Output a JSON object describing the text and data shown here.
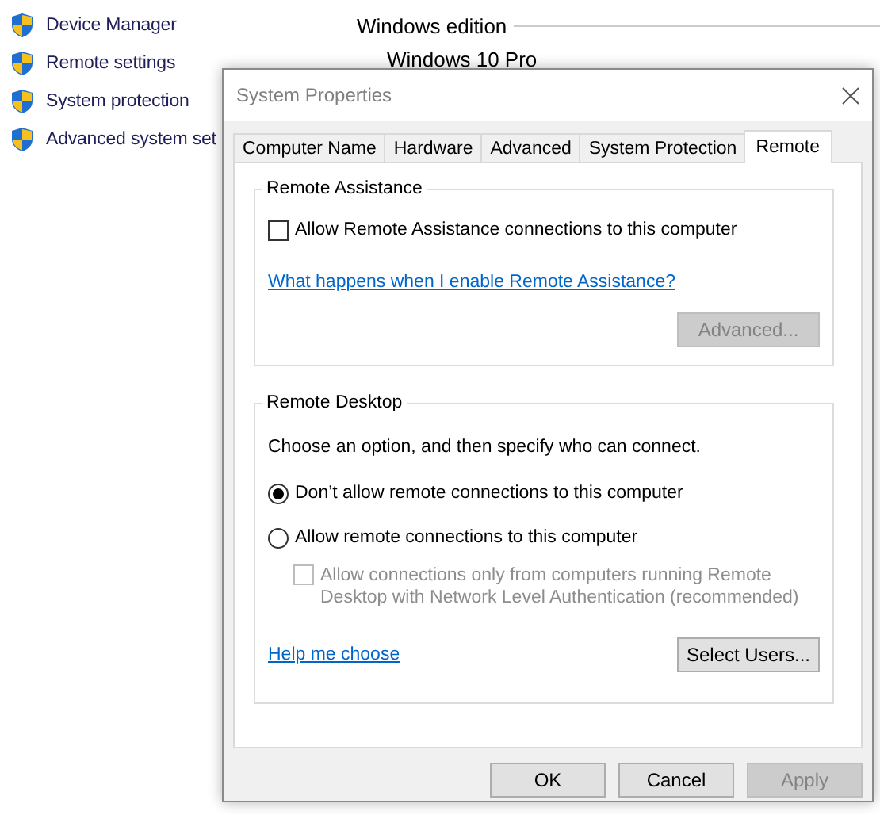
{
  "background": {
    "sidebar": {
      "items": [
        {
          "label": "Device Manager"
        },
        {
          "label": "Remote settings"
        },
        {
          "label": "System protection"
        },
        {
          "label": "Advanced system set"
        }
      ]
    },
    "section_title": "Windows edition",
    "edition": "Windows 10 Pro"
  },
  "dialog": {
    "title": "System Properties",
    "tabs": [
      {
        "label": "Computer Name",
        "selected": false
      },
      {
        "label": "Hardware",
        "selected": false
      },
      {
        "label": "Advanced",
        "selected": false
      },
      {
        "label": "System Protection",
        "selected": false
      },
      {
        "label": "Remote",
        "selected": true
      }
    ],
    "remote_assistance": {
      "title": "Remote Assistance",
      "allow": {
        "label": "Allow Remote Assistance connections to this computer",
        "checked": false
      },
      "help_link": "What happens when I enable Remote Assistance?",
      "advanced_button": {
        "label": "Advanced...",
        "disabled": true
      }
    },
    "remote_desktop": {
      "title": "Remote Desktop",
      "instructions": "Choose an option, and then specify who can connect.",
      "options": [
        {
          "label": "Don’t allow remote connections to this computer",
          "selected": true
        },
        {
          "label": "Allow remote connections to this computer",
          "selected": false
        }
      ],
      "nla": {
        "label": "Allow connections only from computers running Remote Desktop with Network Level Authentication (recommended)",
        "checked": false,
        "disabled": true
      },
      "help_link": "Help me choose",
      "select_users_button": {
        "label": "Select Users...",
        "disabled": false
      }
    },
    "buttons": [
      {
        "label": "OK",
        "disabled": false
      },
      {
        "label": "Cancel",
        "disabled": false
      },
      {
        "label": "Apply",
        "disabled": true
      }
    ]
  }
}
